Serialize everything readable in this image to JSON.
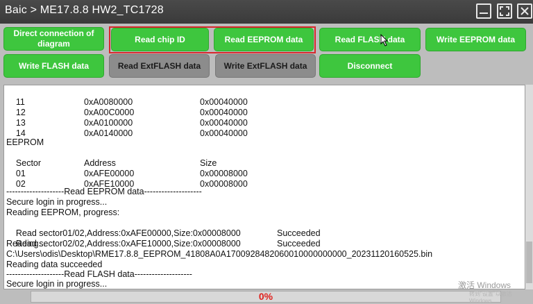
{
  "window": {
    "title": "Baic > ME17.8.8 HW2_TC1728"
  },
  "buttons": {
    "direct_connection": "Direct connection of diagram",
    "read_chip_id": "Read chip ID",
    "read_eeprom": "Read EEPROM data",
    "read_flash": "Read FLASH data",
    "write_eeprom": "Write EEPROM data",
    "write_flash": "Write FLASH data",
    "read_extflash": "Read ExtFLASH data",
    "write_extflash": "Write ExtFLASH data",
    "disconnect": "Disconnect"
  },
  "log": {
    "flash_rows": [
      {
        "sector": "11",
        "address": "0xA0080000",
        "size": "0x00040000"
      },
      {
        "sector": "12",
        "address": "0xA00C0000",
        "size": "0x00040000"
      },
      {
        "sector": "13",
        "address": "0xA0100000",
        "size": "0x00040000"
      },
      {
        "sector": "14",
        "address": "0xA0140000",
        "size": "0x00040000"
      }
    ],
    "eeprom_header": "EEPROM",
    "col_sector": "Sector",
    "col_address": "Address",
    "col_size": "Size",
    "eeprom_rows": [
      {
        "sector": "01",
        "address": "0xAFE00000",
        "size": "0x00008000"
      },
      {
        "sector": "02",
        "address": "0xAFE10000",
        "size": "0x00008000"
      }
    ],
    "sep_read_eeprom": "--------------------Read EEPROM data--------------------",
    "secure_login_1": "Secure login in progress...",
    "reading_eeprom": "Reading EEPROM, progress:",
    "read_sector_1": "Read sector01/02,Address:0xAFE00000,Size:0x00008000",
    "read_sector_1_status": "Succeeded",
    "read_sector_2": "Read sector02/02,Address:0xAFE10000,Size:0x00008000",
    "read_sector_2_status": "Succeeded",
    "reading": "Reading...",
    "file_path": "C:\\Users\\odis\\Desktop\\RME17.8.8_EEPROM_41808A0A1700928482060010000000000_20231120160525.bin",
    "reading_succeeded": "Reading data succeeded",
    "sep_read_flash": "--------------------Read FLASH data--------------------",
    "secure_login_2": "Secure login in progress..."
  },
  "progress": {
    "label": "0%",
    "value": 0
  },
  "watermark": {
    "line1": "激活 Windows",
    "line2": "转到\"设置\"以激活 Windows"
  },
  "colors": {
    "button_green": "#3ec63e",
    "button_gray": "#8c8c8c",
    "highlight_red": "#d9262b",
    "progress_text": "#e0201c"
  }
}
